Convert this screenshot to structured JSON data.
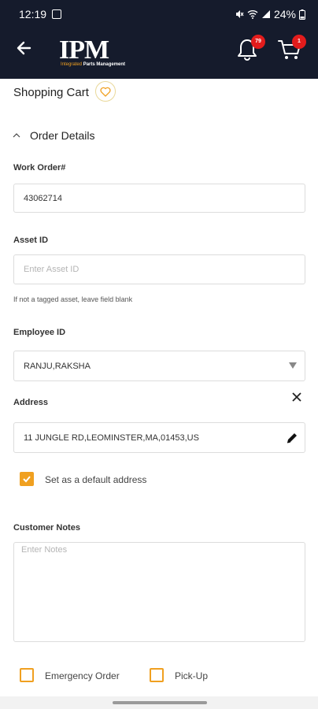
{
  "status_bar": {
    "time": "12:19",
    "battery": "24%"
  },
  "app_bar": {
    "logo_text": "IPM",
    "logo_subtext_1": "Integrated",
    "logo_subtext_2": "Parts Management",
    "notifications_count": "79",
    "cart_count": "1",
    "brand_color": "#151b2c",
    "badge_color": "#e31c1c"
  },
  "page": {
    "title": "Shopping Cart",
    "section_label": "Order Details"
  },
  "form": {
    "work_order_label": "Work Order#",
    "work_order_value": "43062714",
    "asset_id_label": "Asset ID",
    "asset_id_placeholder": "Enter Asset ID",
    "asset_id_hint": "If not a tagged asset, leave field blank",
    "employee_id_label": "Employee ID",
    "employee_id_value": "RANJU,RAKSHA",
    "address_label": "Address",
    "address_value": "11 JUNGLE RD,LEOMINSTER,MA,01453,US",
    "default_address_label": "Set as a default address",
    "default_address_checked": true,
    "customer_notes_label": "Customer Notes",
    "customer_notes_placeholder": "Enter Notes",
    "emergency_order_label": "Emergency Order",
    "emergency_order_checked": false,
    "pickup_label": "Pick-Up",
    "pickup_checked": false,
    "accent_color": "#f0a020"
  }
}
